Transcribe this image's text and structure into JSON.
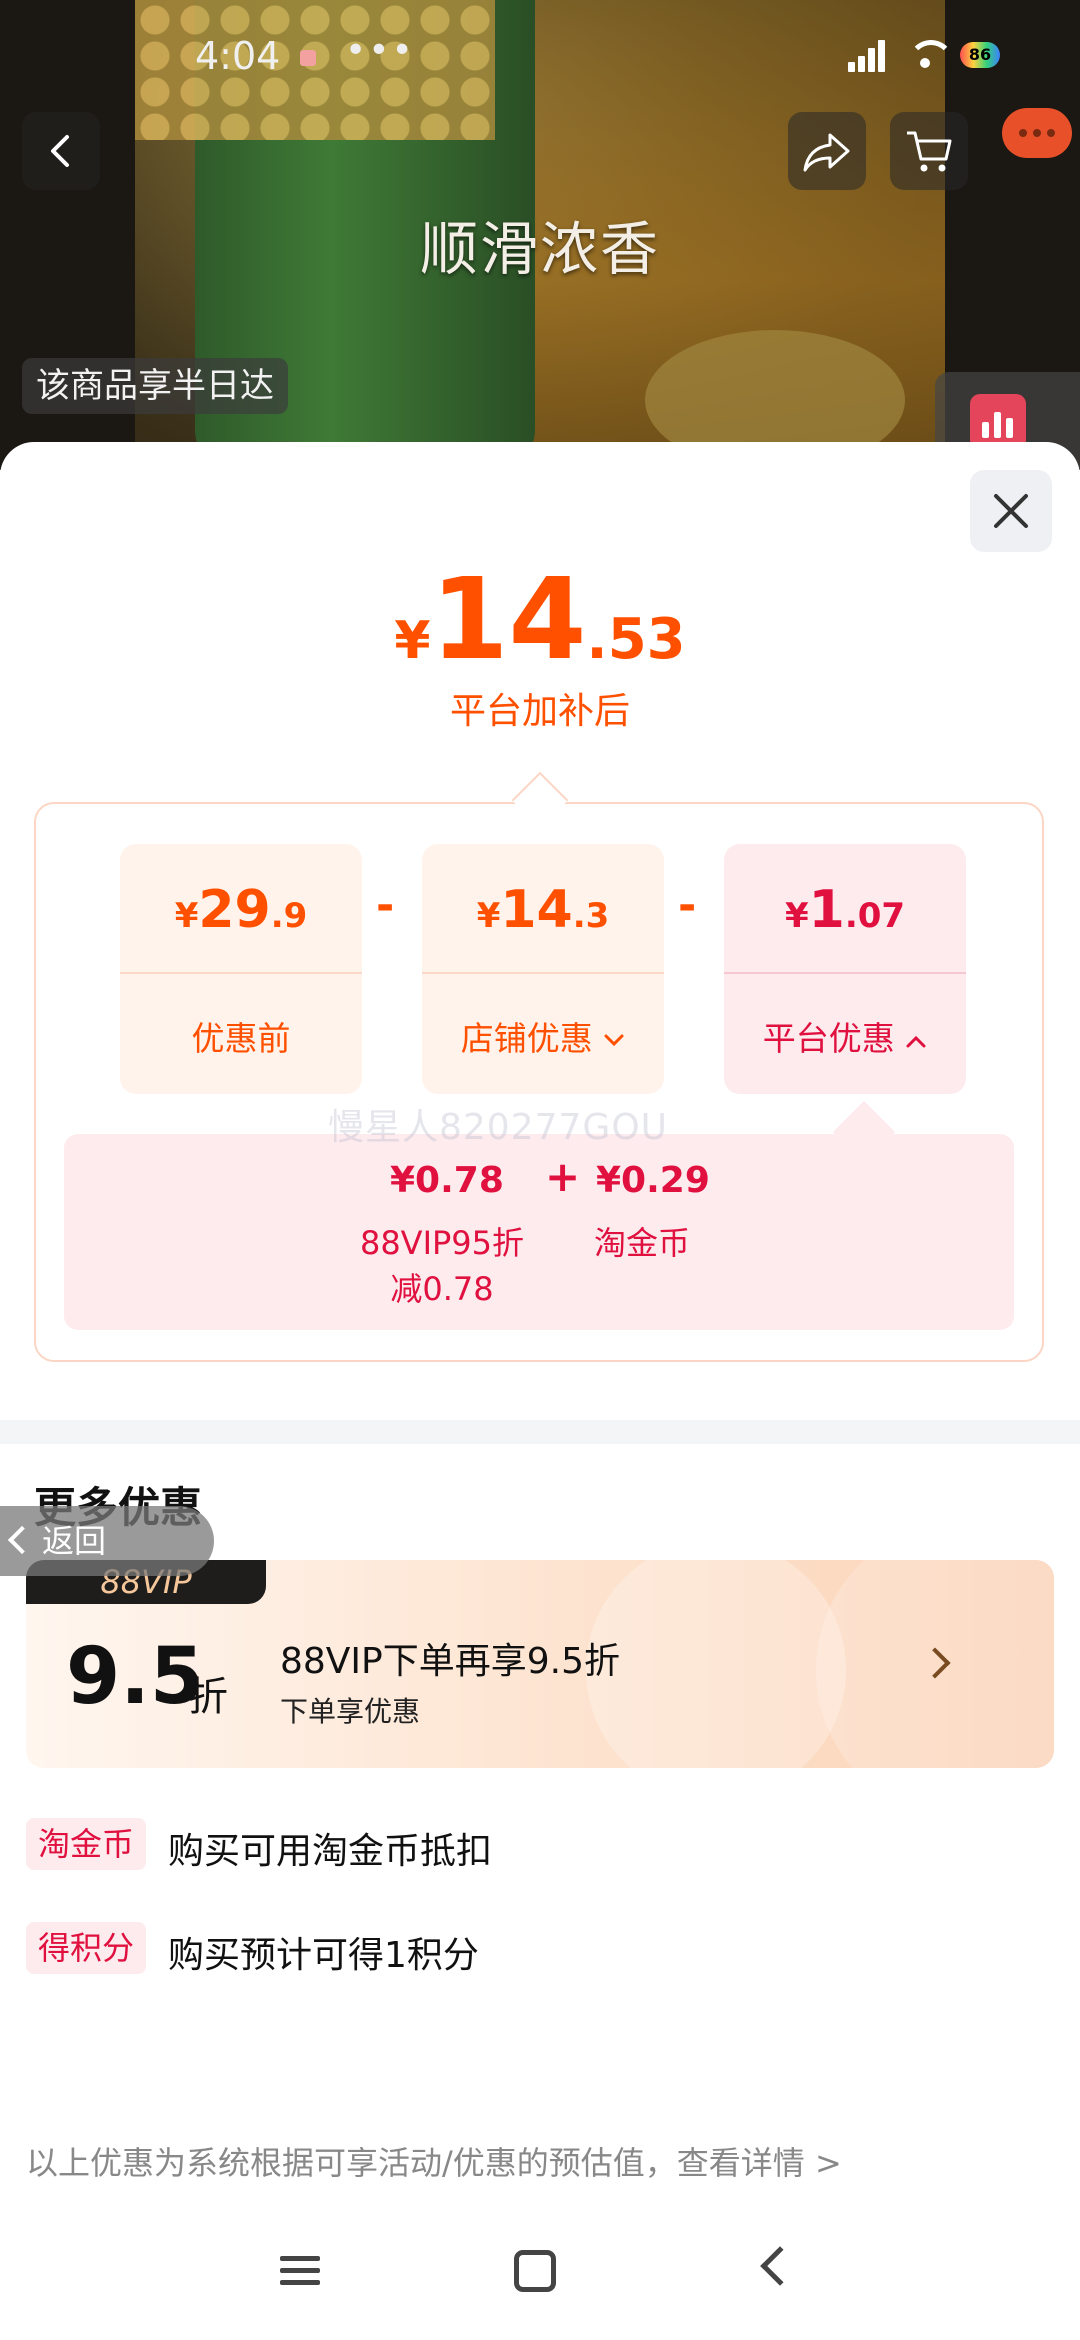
{
  "status_bar": {
    "time": "4:04",
    "more": "•••",
    "battery": "86"
  },
  "header": {
    "hero_text": "顺滑浓香",
    "delivery_badge": "该商品享半日达",
    "icons": [
      "back-icon",
      "share-icon",
      "cart-icon",
      "chat-icon",
      "chart-icon"
    ]
  },
  "price": {
    "currency": "¥",
    "integer": "14",
    "decimal": ".53",
    "subtitle": "平台加补后"
  },
  "breakdown": {
    "cards": [
      {
        "currency": "¥",
        "integer": "29",
        "decimal": ".9",
        "label": "优惠前"
      },
      {
        "currency": "¥",
        "integer": "14",
        "decimal": ".3",
        "label": "店铺优惠"
      },
      {
        "currency": "¥",
        "integer": "1",
        "decimal": ".07",
        "label": "平台优惠"
      }
    ],
    "operator_minus": "-",
    "operator_plus": "+",
    "platform_items": [
      {
        "value": "¥0.78",
        "label_line1": "88VIP95折",
        "label_line2": "减0.78"
      },
      {
        "value": "¥0.29",
        "label_line1": "淘金币",
        "label_line2": ""
      }
    ],
    "watermark": "慢星人820277GOU"
  },
  "more": {
    "title": "更多优惠",
    "back_label": "返回",
    "vip": {
      "tag": "88VIP",
      "discount_number": "9.5",
      "discount_unit": "折",
      "title": "88VIP下单再享9.5折",
      "subtitle": "下单享优惠"
    },
    "rows": [
      {
        "tag": "淘金币",
        "text": "购买可用淘金币抵扣"
      },
      {
        "tag": "得积分",
        "text": "购买预计可得1积分"
      }
    ]
  },
  "footnote": "以上优惠为系统根据可享活动/优惠的预估值，查看详情 >",
  "colors": {
    "accent": "#ff5000",
    "platform": "#e0103f"
  }
}
